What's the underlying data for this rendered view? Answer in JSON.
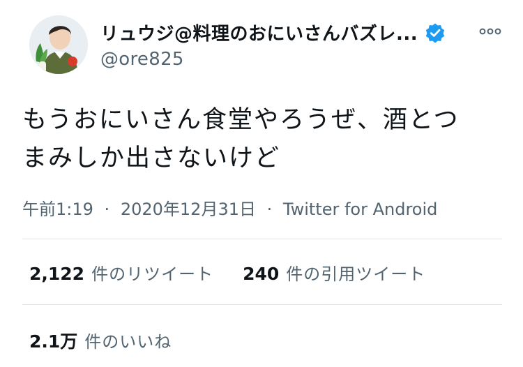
{
  "user": {
    "display_name": "リュウジ@料理のおにいさんバズレ...",
    "handle": "@ore825",
    "verified": true,
    "avatar_icon": "avatar-photo-icon",
    "verified_icon": "verified-badge-icon",
    "more_icon": "more-options-icon"
  },
  "tweet": {
    "text_line1": "もうおにいさん食堂やろうぜ、酒とつ",
    "text_line2": "まみしか出さないけど"
  },
  "meta": {
    "time": "午前1:19",
    "separator": "·",
    "date": "2020年12月31日",
    "source": "Twitter for Android"
  },
  "stats": {
    "retweets_count": "2,122",
    "retweets_label": "件のリツイート",
    "quotes_count": "240",
    "quotes_label": "件の引用ツイート",
    "likes_count": "2.1万",
    "likes_label": "件のいいね"
  },
  "colors": {
    "verified_blue": "#1d9bf0",
    "secondary_text": "#536471",
    "primary_text": "#0f1419"
  }
}
